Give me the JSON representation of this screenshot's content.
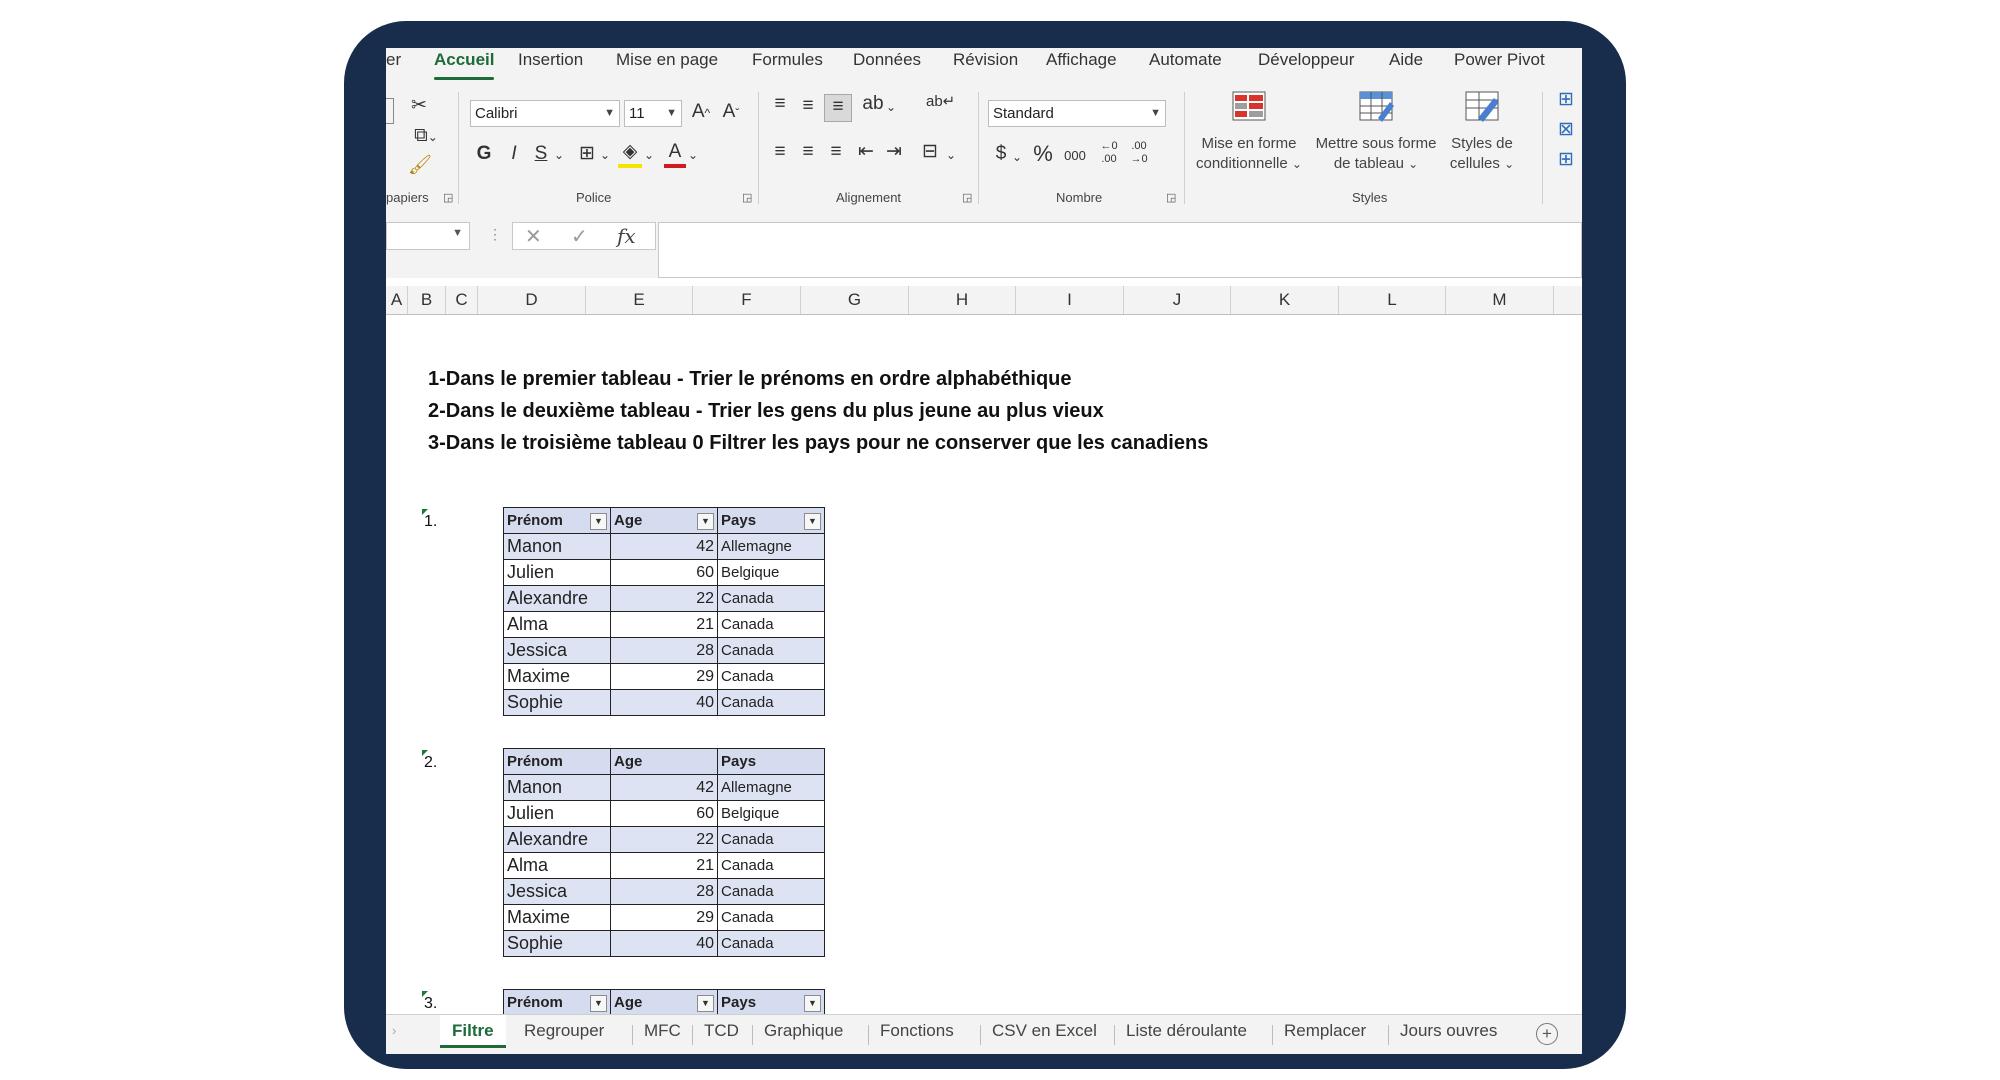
{
  "ribbon_tabs": [
    "er",
    "Accueil",
    "Insertion",
    "Mise en page",
    "Formules",
    "Données",
    "Révision",
    "Affichage",
    "Automate",
    "Développeur",
    "Aide",
    "Power Pivot"
  ],
  "active_tab": "Accueil",
  "ribbon": {
    "clipboard_label": "papiers",
    "font_label": "Police",
    "font_name": "Calibri",
    "font_size": "11",
    "alignment_label": "Alignement",
    "number_label": "Nombre",
    "number_format": "Standard",
    "styles_label": "Styles",
    "bold": "G",
    "italic": "I",
    "underline": "S",
    "currency": "$",
    "percent": "%",
    "thousands": "000",
    "inc_decimal": "←0\n.00",
    "dec_decimal": ".00\n→0",
    "cond_format_l1": "Mise en forme",
    "cond_format_l2": "conditionnelle",
    "table_format_l1": "Mettre sous forme",
    "table_format_l2": "de tableau",
    "cell_styles_l1": "Styles de",
    "cell_styles_l2": "cellules"
  },
  "formula_bar": {
    "fx": "fx",
    "cancel": "✕",
    "confirm": "✓"
  },
  "columns": [
    "A",
    "B",
    "C",
    "D",
    "E",
    "F",
    "G",
    "H",
    "I",
    "J",
    "K",
    "L",
    "M"
  ],
  "instructions": [
    "1-Dans le premier tableau - Trier le prénoms en ordre alphabéthique",
    "2-Dans le deuxième tableau - Trier les gens du plus jeune au plus vieux",
    "3-Dans le troisième tableau 0 Filtrer les pays pour ne conserver que les canadiens"
  ],
  "table_numbers": [
    "1.",
    "2.",
    "3."
  ],
  "table_headers": [
    "Prénom",
    "Age",
    "Pays"
  ],
  "rows": [
    [
      "Manon",
      "42",
      "Allemagne"
    ],
    [
      "Julien",
      "60",
      "Belgique"
    ],
    [
      "Alexandre",
      "22",
      "Canada"
    ],
    [
      "Alma",
      "21",
      "Canada"
    ],
    [
      "Jessica",
      "28",
      "Canada"
    ],
    [
      "Maxime",
      "29",
      "Canada"
    ],
    [
      "Sophie",
      "40",
      "Canada"
    ]
  ],
  "sheet_tabs": [
    "Filtre",
    "Regrouper",
    "MFC",
    "TCD",
    "Graphique",
    "Fonctions",
    "CSV en Excel",
    "Liste déroulante",
    "Remplacer",
    "Jours ouvres"
  ],
  "active_sheet": "Filtre",
  "add_sheet": "+"
}
